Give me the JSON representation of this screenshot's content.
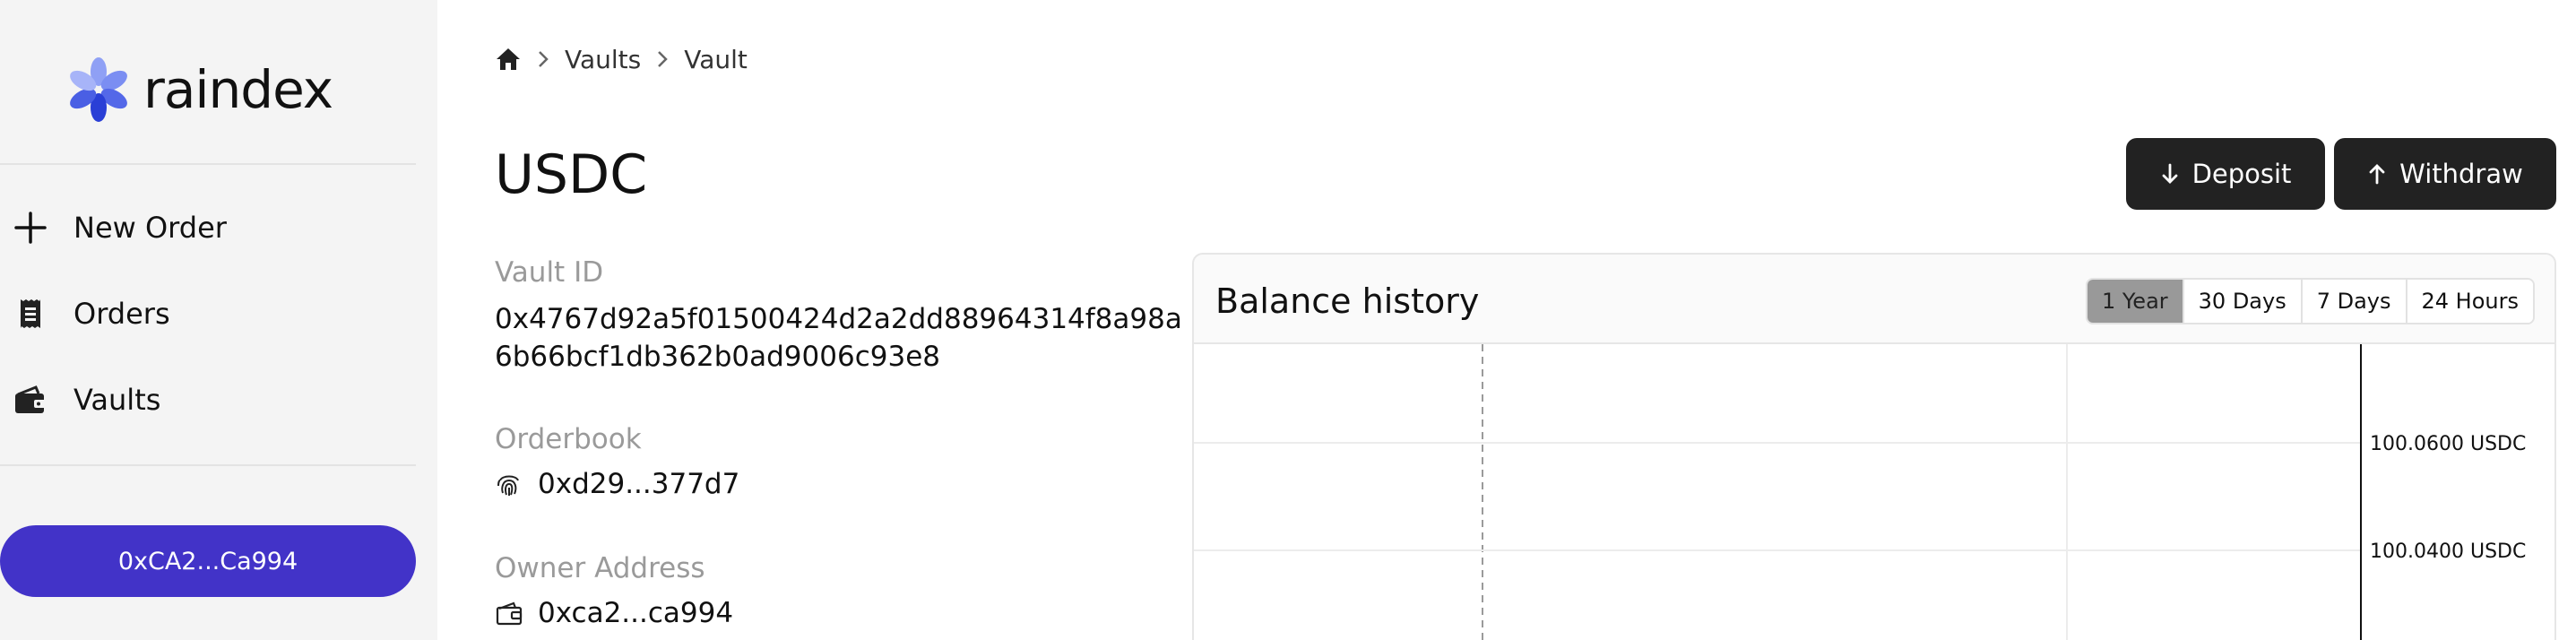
{
  "brand": {
    "name": "raindex"
  },
  "nav": {
    "items": [
      {
        "label": "New Order",
        "icon": "plus-icon"
      },
      {
        "label": "Orders",
        "icon": "receipt-icon"
      },
      {
        "label": "Vaults",
        "icon": "wallet-icon"
      }
    ],
    "wallet_label": "0xCA2...Ca994"
  },
  "breadcrumb": {
    "items": [
      "Vaults",
      "Vault"
    ],
    "home_icon": "home-icon"
  },
  "page": {
    "title": "USDC"
  },
  "actions": {
    "deposit": "Deposit",
    "withdraw": "Withdraw"
  },
  "details": {
    "vault_id_label": "Vault ID",
    "vault_id_line1": "0x4767d92a5f01500424d2a2dd88964314f8a98a",
    "vault_id_line2": "6b66bcf1db362b0ad9006c93e8",
    "orderbook_label": "Orderbook",
    "orderbook_value": "0xd29...377d7",
    "owner_label": "Owner Address",
    "owner_value": "0xca2...ca994"
  },
  "chart_card": {
    "title": "Balance history",
    "ranges": [
      "1 Year",
      "30 Days",
      "7 Days",
      "24 Hours"
    ],
    "active_range": "1 Year"
  },
  "colors": {
    "accent": "#4233c8",
    "button_dark": "#222222",
    "sidebar_bg": "#f4f4f4",
    "range_active": "#999999"
  },
  "chart_data": {
    "type": "line",
    "series": [],
    "y_ticks": [
      "100.0600 USDC",
      "100.0400 USDC"
    ],
    "yaxis_position": "right",
    "grid": true
  }
}
